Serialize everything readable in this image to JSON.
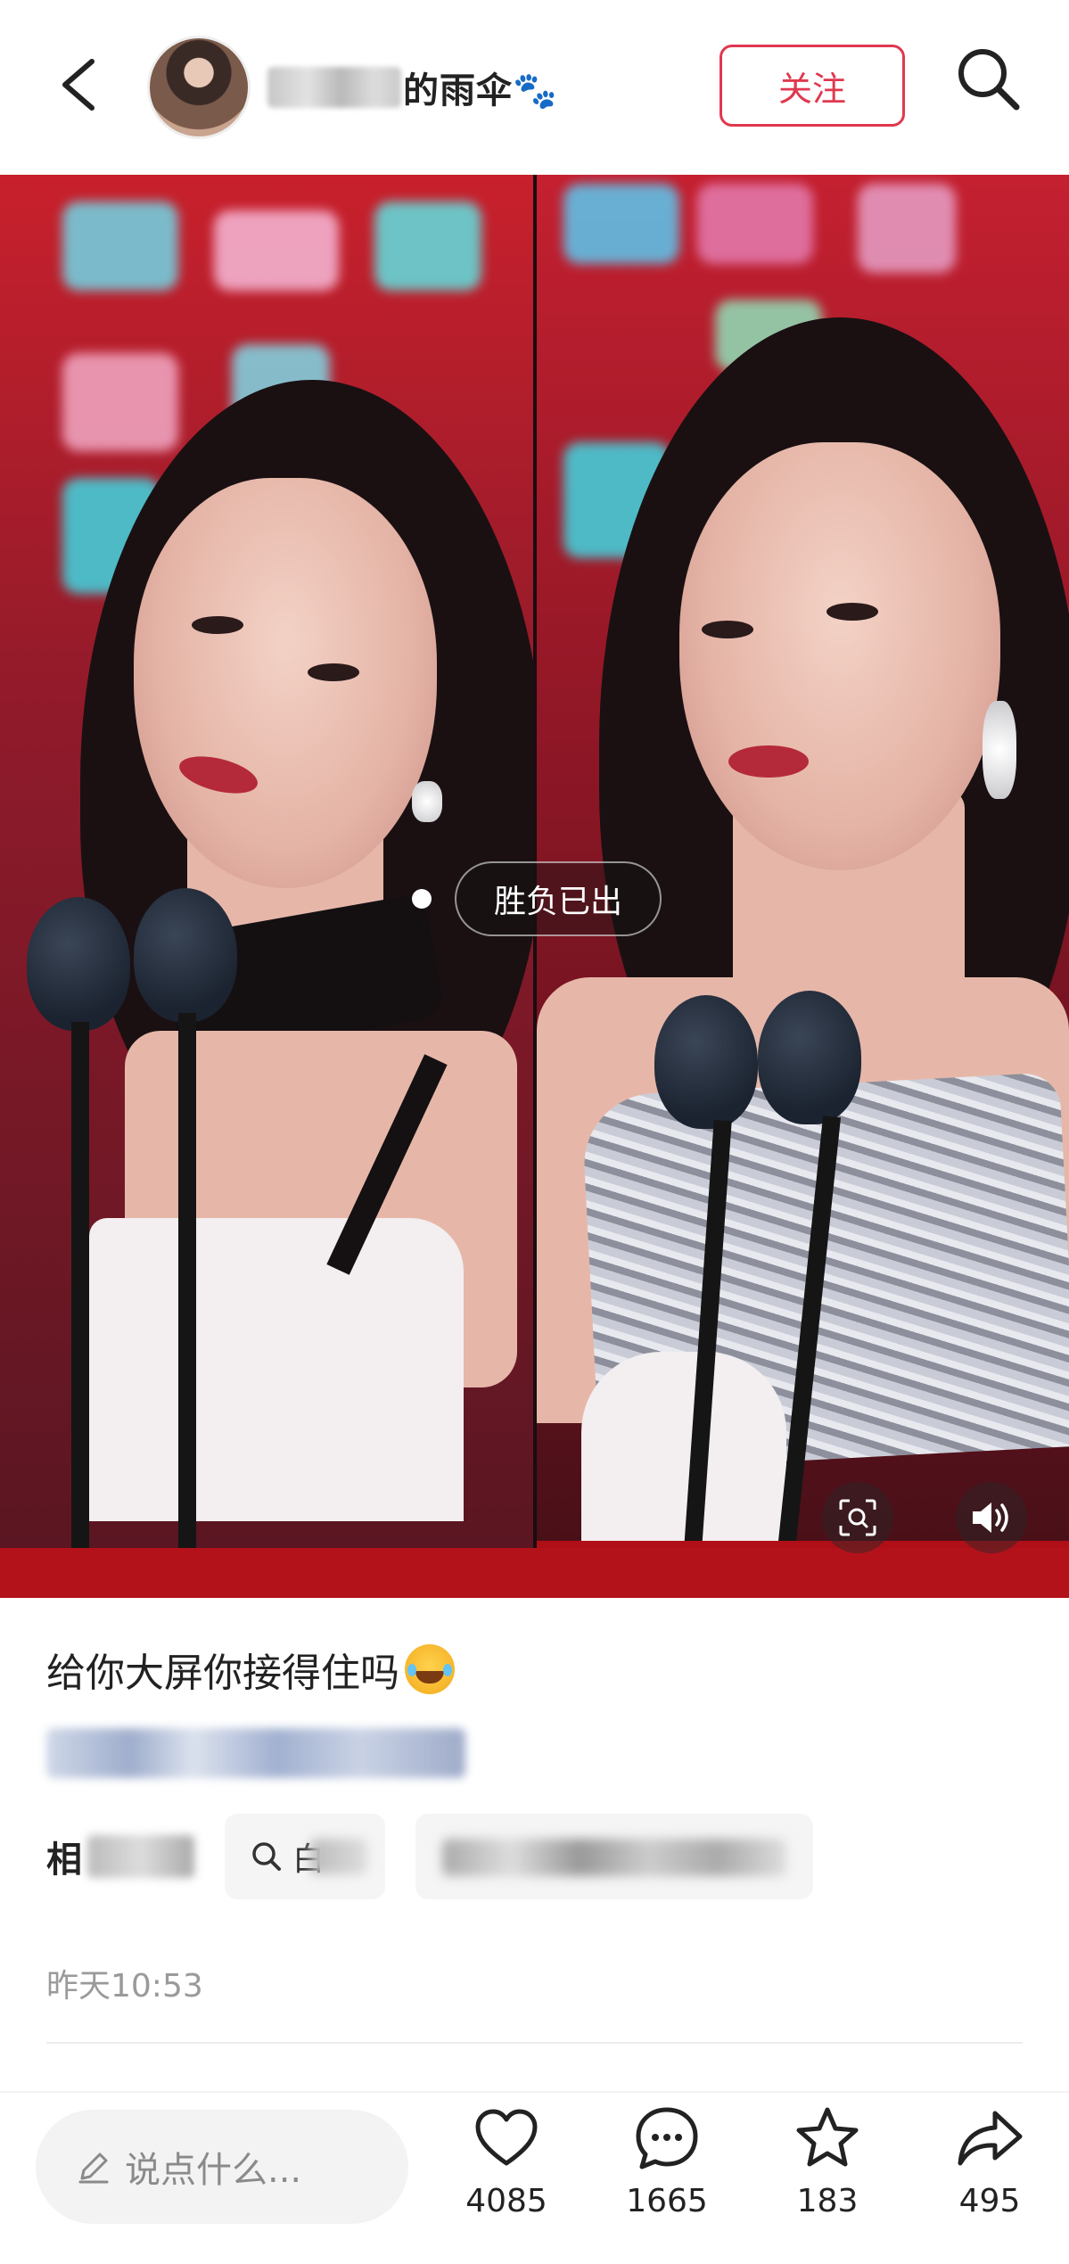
{
  "header": {
    "username": "的雨伞🐾",
    "follow_label": "关注"
  },
  "media": {
    "tag_label": "胜负已出"
  },
  "post": {
    "caption": "给你大屏你接得住吗",
    "caption_emoji": "laughing-tears-emoji",
    "related_label": "相",
    "chip_1_text": "白",
    "timestamp": "昨天10:53"
  },
  "bottom_bar": {
    "comment_placeholder": "说点什么...",
    "like_count": "4085",
    "comment_count": "1665",
    "star_count": "183",
    "share_count": "495"
  },
  "icons": {
    "back": "chevron-left-icon",
    "search": "search-icon",
    "scan": "image-search-icon",
    "volume": "volume-icon",
    "pen": "pen-icon",
    "like": "heart-icon",
    "comment": "comment-icon",
    "star": "star-icon",
    "share": "share-icon"
  },
  "colors": {
    "accent": "#e0384f",
    "muted_text": "#9a9a9a"
  }
}
